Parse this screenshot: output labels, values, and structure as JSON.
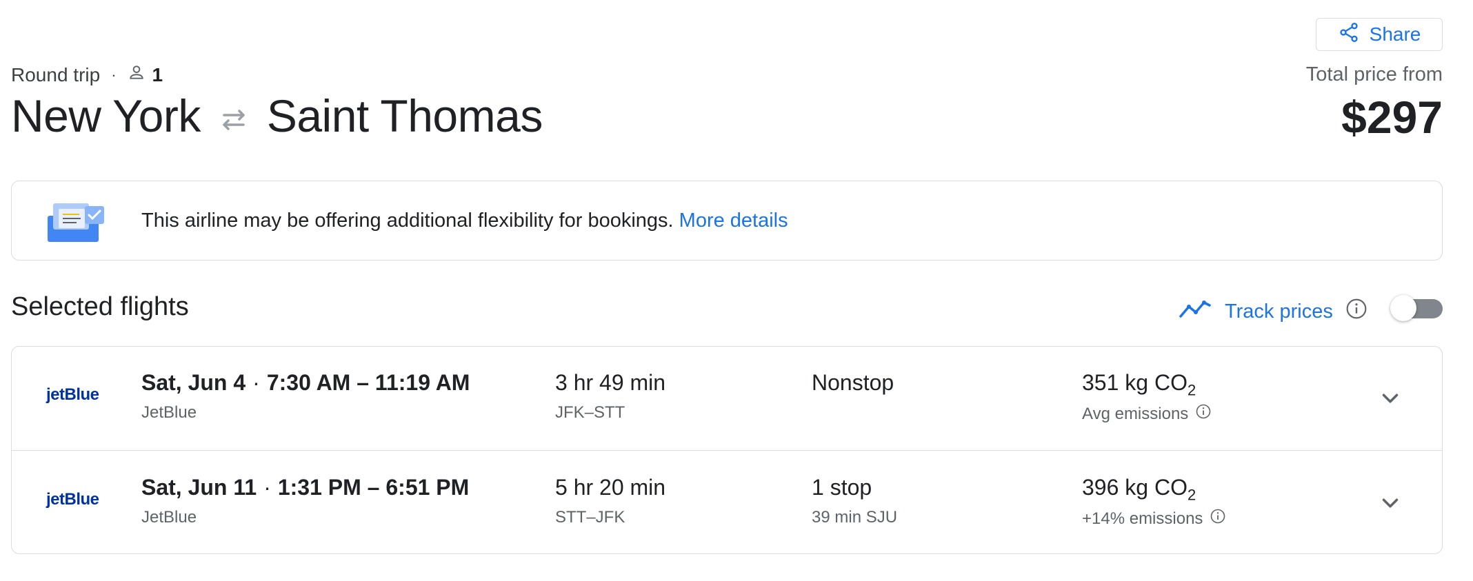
{
  "share": {
    "label": "Share"
  },
  "trip": {
    "type": "Round trip",
    "separator": "·",
    "passengers": "1"
  },
  "route": {
    "origin": "New York",
    "destination": "Saint Thomas"
  },
  "price": {
    "label": "Total price from",
    "value": "$297"
  },
  "banner": {
    "message": "This airline may be offering additional flexibility for bookings.",
    "link": "More details"
  },
  "selected": {
    "title": "Selected flights",
    "track_label": "Track prices",
    "track_enabled": false
  },
  "flights": [
    {
      "logo": "jetBlue",
      "date": "Sat, Jun 4",
      "times": "7:30 AM – 11:19 AM",
      "airline": "JetBlue",
      "duration": "3 hr 49 min",
      "route": "JFK–STT",
      "stops": "Nonstop",
      "stop_detail": "",
      "co2": "351 kg CO",
      "co2_sub": "2",
      "emissions": "Avg emissions"
    },
    {
      "logo": "jetBlue",
      "date": "Sat, Jun 11",
      "times": "1:31 PM – 6:51 PM",
      "airline": "JetBlue",
      "duration": "5 hr 20 min",
      "route": "STT–JFK",
      "stops": "1 stop",
      "stop_detail": "39 min SJU",
      "co2": "396 kg CO",
      "co2_sub": "2",
      "emissions": "+14% emissions"
    }
  ],
  "colors": {
    "accent": "#1a73e8",
    "text": "#202124",
    "muted": "#5f6368",
    "border": "#dadce0",
    "jetblue": "#0033a0"
  }
}
